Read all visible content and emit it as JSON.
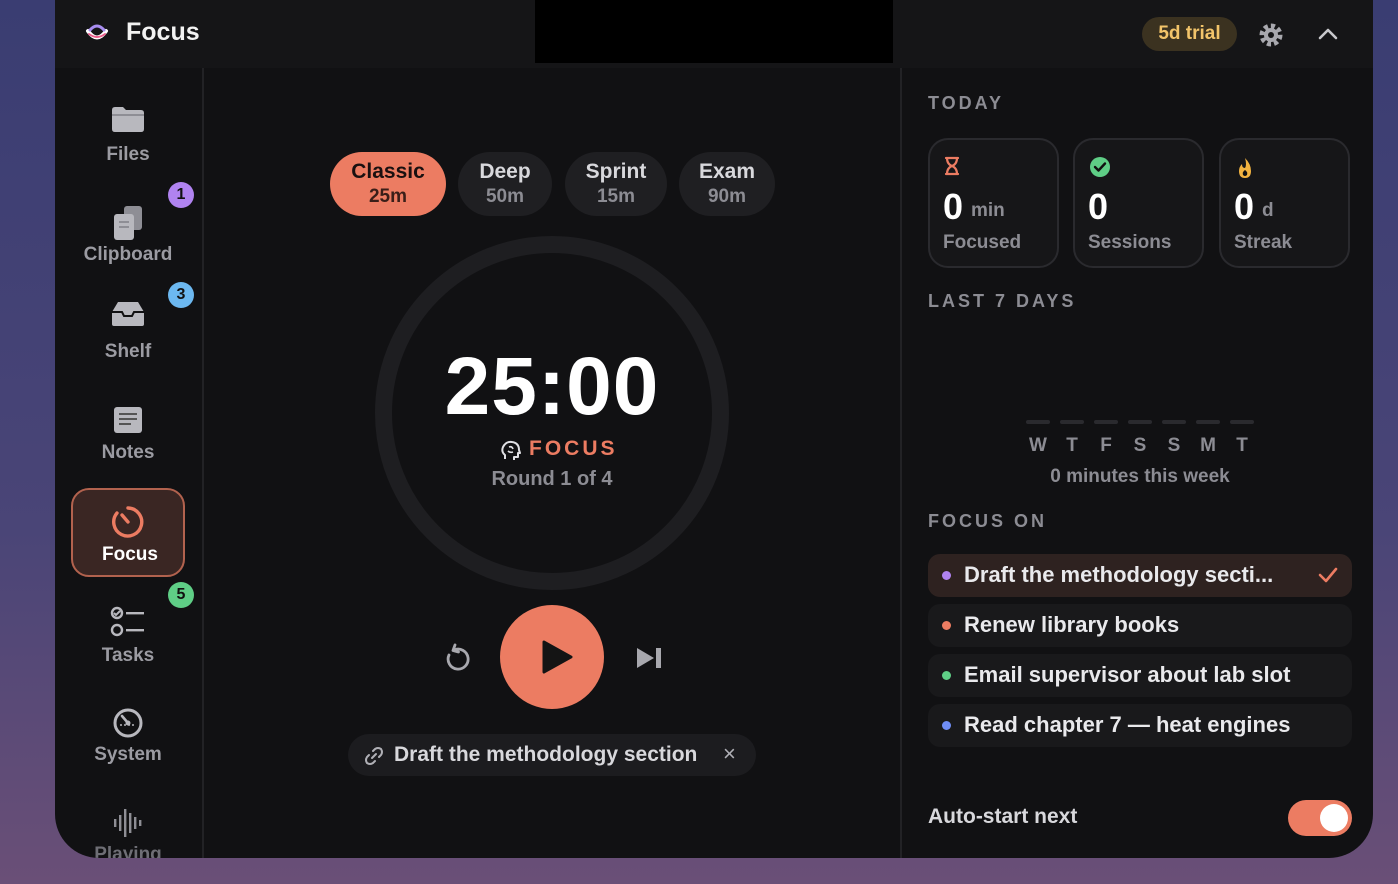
{
  "app": {
    "title": "Focus",
    "trial_badge": "5d trial"
  },
  "sidebar": {
    "items": [
      {
        "label": "Files"
      },
      {
        "label": "Clipboard",
        "badge": "1"
      },
      {
        "label": "Shelf",
        "badge": "3"
      },
      {
        "label": "Notes"
      },
      {
        "label": "Focus",
        "active": true
      },
      {
        "label": "Tasks",
        "badge": "5"
      },
      {
        "label": "System"
      },
      {
        "label": "Playing"
      }
    ]
  },
  "timer": {
    "presets": [
      {
        "name": "Classic",
        "duration": "25m",
        "active": true
      },
      {
        "name": "Deep",
        "duration": "50m"
      },
      {
        "name": "Sprint",
        "duration": "15m"
      },
      {
        "name": "Exam",
        "duration": "90m"
      }
    ],
    "time": "25:00",
    "mode": "FOCUS",
    "round": "Round 1 of 4",
    "linked_task": "Draft the methodology section",
    "remove_glyph": "×"
  },
  "today": {
    "heading": "TODAY",
    "focused": {
      "value": "0",
      "unit": "min",
      "label": "Focused"
    },
    "sessions": {
      "value": "0",
      "label": "Sessions"
    },
    "streak": {
      "value": "0",
      "unit": "d",
      "label": "Streak"
    }
  },
  "last7": {
    "heading": "LAST 7 DAYS",
    "days": [
      "W",
      "T",
      "F",
      "S",
      "S",
      "M",
      "T"
    ],
    "summary": "0 minutes this week"
  },
  "focus_on": {
    "heading": "FOCUS ON",
    "tasks": [
      {
        "text": "Draft the methodology secti...",
        "color": "#b083f0",
        "selected": true
      },
      {
        "text": "Renew library books",
        "color": "#ec7c62"
      },
      {
        "text": "Email supervisor about lab slot",
        "color": "#5fce86"
      },
      {
        "text": "Read chapter 7 — heat engines",
        "color": "#6f8df5"
      }
    ]
  },
  "auto_start": {
    "label": "Auto-start next",
    "enabled": true
  },
  "colors": {
    "accent": "#ec7c62",
    "trial_text": "#f2c46a",
    "success": "#5fce86"
  }
}
